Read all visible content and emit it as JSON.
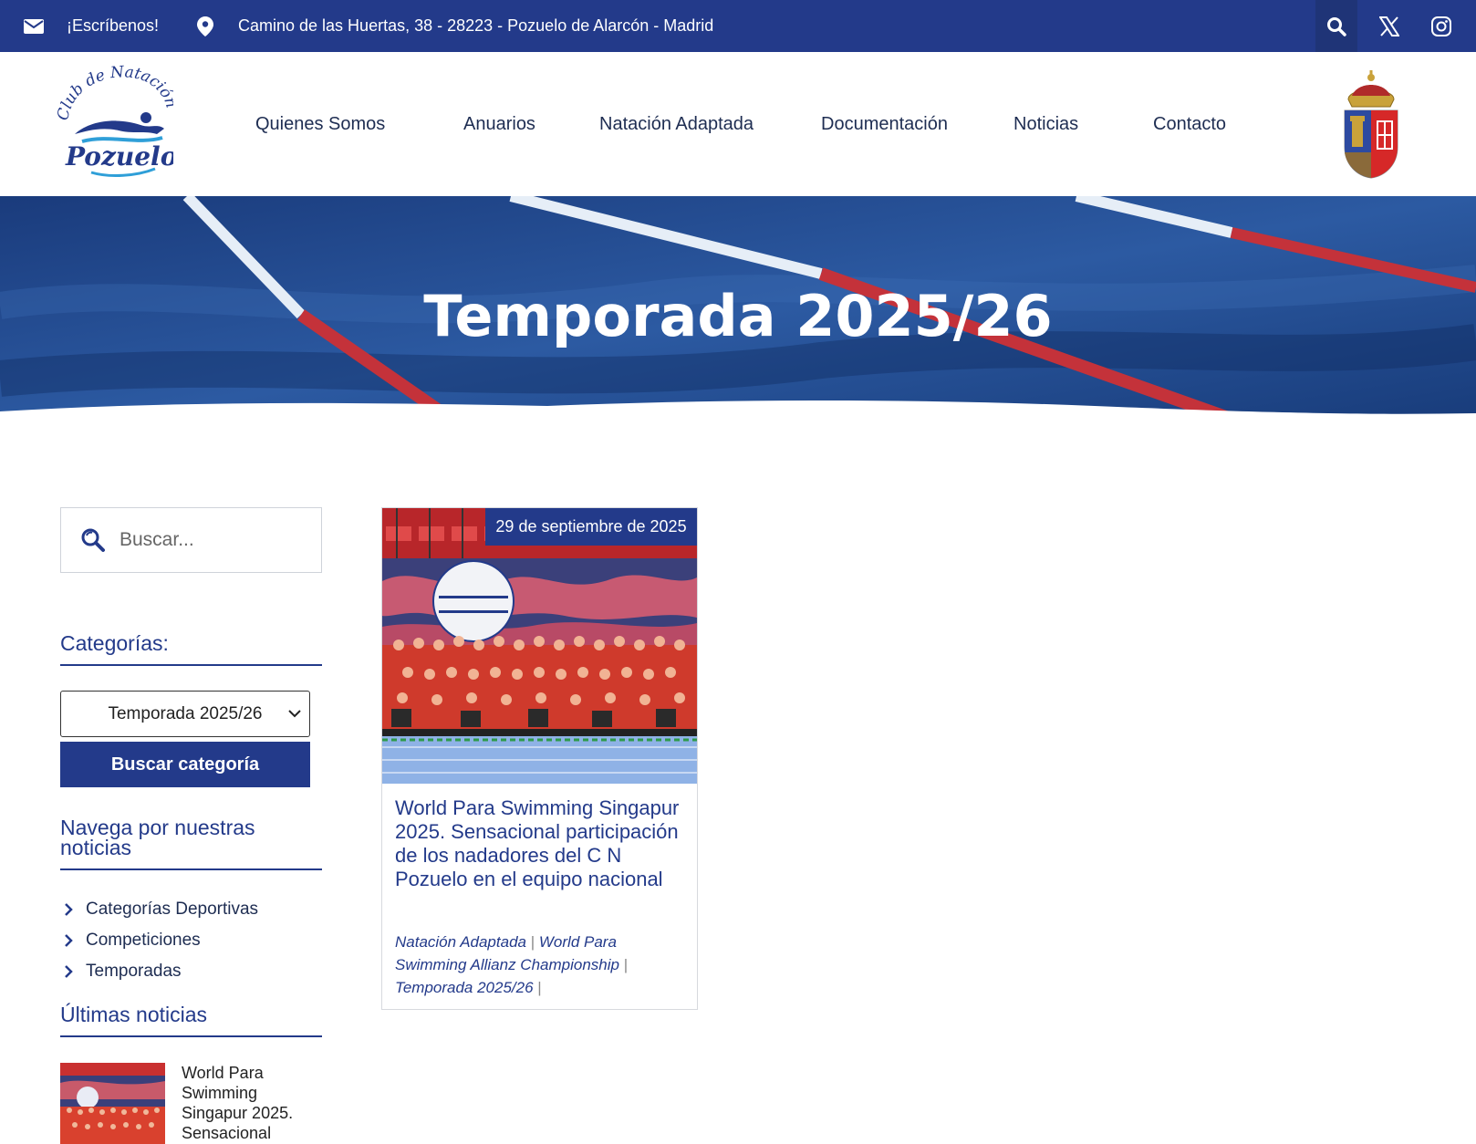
{
  "topbar": {
    "email_label": "¡Escríbenos!",
    "address": "Camino de las Huertas, 38 - 28223 - Pozuelo de Alarcón - Madrid",
    "icons": [
      "envelope-icon",
      "location-pin-icon",
      "search-icon",
      "x-twitter-icon",
      "instagram-icon"
    ],
    "color": "#233a8a"
  },
  "header": {
    "logo_text": [
      "Club de Natación",
      "Pozuelo"
    ],
    "nav": [
      "Quienes Somos",
      "Anuarios",
      "Natación Adaptada",
      "Documentación",
      "Noticias",
      "Contacto"
    ]
  },
  "hero": {
    "title": "Temporada 2025/26"
  },
  "sidebar": {
    "search_placeholder": "Buscar...",
    "categories_title": "Categorías:",
    "selected_category": "Temporada 2025/26",
    "category_button": "Buscar categoría",
    "browse_title": "Navega por nuestras noticias",
    "browse_items": [
      "Categorías Deportivas",
      "Competiciones",
      "Temporadas"
    ],
    "latest_title": "Últimas noticias",
    "latest_item": "World Para Swimming Singapur 2025. Sensacional"
  },
  "post": {
    "date": "29 de septiembre de 2025",
    "title": "World Para Swimming Singapur 2025. Sensacional participación de los nadadores del C N Pozuelo en el equipo nacional",
    "tags": [
      "Natación Adaptada",
      "World Para Swimming Allianz Championship",
      "Temporada 2025/26"
    ],
    "tag_separator": "|"
  }
}
